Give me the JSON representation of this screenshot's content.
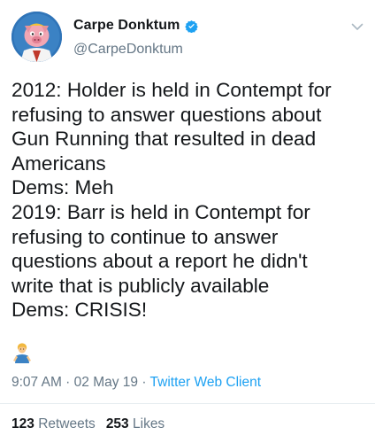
{
  "author": {
    "display_name": "Carpe Donktum",
    "handle": "@CarpeDonktum",
    "verified": true
  },
  "tweet": {
    "lines": [
      "2012: Holder is held in Contempt for",
      "refusing to answer questions about",
      "Gun Running that resulted in dead",
      "Americans",
      "Dems: Meh",
      "2019: Barr is held in Contempt for",
      "refusing to continue to answer",
      "questions about a report he didn't",
      "write that is publicly available",
      "Dems: CRISIS!"
    ],
    "emoji": "man-gesturing-emoji"
  },
  "meta": {
    "time": "9:07 AM",
    "date": "02 May 19",
    "separator": " · ",
    "client": "Twitter Web Client"
  },
  "stats": {
    "retweets_count": "123",
    "retweets_label": "Retweets",
    "likes_count": "253",
    "likes_label": "Likes"
  },
  "colors": {
    "text": "#14171a",
    "secondary": "#657786",
    "accent": "#1da1f2",
    "divider": "#e6ecf0"
  }
}
